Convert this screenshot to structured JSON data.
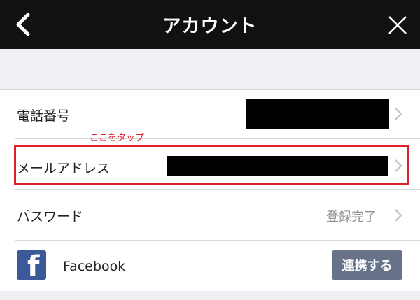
{
  "header": {
    "title": "アカウント"
  },
  "rows": [
    {
      "label": "電話番号"
    },
    {
      "label": "メールアドレス"
    },
    {
      "label": "パスワード",
      "value": "登録完了"
    },
    {
      "label": "Facebook",
      "button_label": "連携する"
    }
  ],
  "annotation": {
    "text": "ここをタップ",
    "color": "#e0202a"
  },
  "colors": {
    "header_bg": "#111111",
    "facebook_blue": "#3b5998",
    "link_button": "#68738a"
  },
  "icons": {
    "back": "chevron-left-icon",
    "close": "close-icon",
    "row_chevron": "chevron-right-icon",
    "facebook": "facebook-logo-icon"
  }
}
